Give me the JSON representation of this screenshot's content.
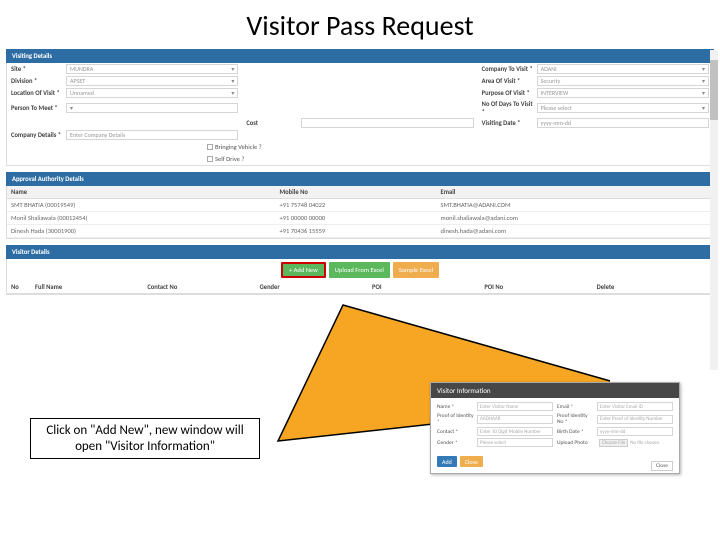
{
  "title": "Visitor Pass Request",
  "sections": {
    "visiting": {
      "header": "Visiting Details"
    },
    "approval": {
      "header": "Approval Authority Details"
    },
    "visitors": {
      "header": "Visitor Details"
    }
  },
  "visiting_details": {
    "site": {
      "label": "Site *",
      "value": "MUNDRA"
    },
    "company_to_visit": {
      "label": "Company To Visit *",
      "value": "ADANI"
    },
    "division": {
      "label": "Division *",
      "value": "APSET"
    },
    "area_of_visit": {
      "label": "Area Of Visit *",
      "value": "Security"
    },
    "location": {
      "label": "Location Of Visit *",
      "value": "Unnamed"
    },
    "purpose": {
      "label": "Purpose Of Visit *",
      "value": "INTERVIEW"
    },
    "person_to_meet": {
      "label": "Person To Meet *",
      "value": ""
    },
    "days_to_visit": {
      "label": "No Of Days To Visit *",
      "value": "Please select"
    },
    "cost": {
      "label": "Cost",
      "value": ""
    },
    "visiting_date": {
      "label": "Visiting Date *",
      "value": "yyyy-mm-dd"
    },
    "company_details": {
      "label": "Company Details *",
      "placeholder": "Enter Company Details"
    },
    "bringing_vehicle": "Bringing Vehicle ?",
    "self_drive": "Self Drive ?"
  },
  "approval_table": {
    "headers": {
      "name": "Name",
      "mobile": "Mobile No",
      "email": "Email"
    },
    "rows": [
      {
        "name": "SMT BHATIA (00019549)",
        "mobile": "+91 75748 04022",
        "email": "SMT.BHATIA@ADANI.COM"
      },
      {
        "name": "Monil Shaliawala (00012454)",
        "mobile": "+91 00000 00000",
        "email": "monil.shaliawala@adani.com"
      },
      {
        "name": "Dinesh Hada (30001900)",
        "mobile": "+91 70436 15559",
        "email": "dinesh.hada@adani.com"
      }
    ]
  },
  "toolbar": {
    "add_new": "+ Add New",
    "upload": "Upload From Excel",
    "sample": "Sample Excel"
  },
  "detail_headers": [
    "No",
    "Full Name",
    "Contact No",
    "Gender",
    "POI",
    "POI No",
    "Delete"
  ],
  "callout": "Click on \"Add New\", new window will open \"Visitor Information\"",
  "modal": {
    "title": "Visitor Information",
    "fields": {
      "name": {
        "label": "Name *",
        "placeholder": "Enter Visitor Name"
      },
      "email": {
        "label": "Email *",
        "placeholder": "Enter Visitor Email ID"
      },
      "poi": {
        "label": "Proof of Identity *",
        "value": "AADHAAR"
      },
      "poi_no": {
        "label": "Proof Identity No *",
        "placeholder": "Enter Proof of Identity Number"
      },
      "contact": {
        "label": "Contact *",
        "placeholder": "Enter 10 Digit Mobile Number"
      },
      "birth_date": {
        "label": "Birth Date *",
        "placeholder": "yyyy-mm-dd"
      },
      "gender": {
        "label": "Gender *",
        "value": "Please select"
      },
      "upload": {
        "label": "Upload Photo",
        "button": "Choose File",
        "status": "No file chosen"
      }
    },
    "add": "Add",
    "close_footer": "Close",
    "close_modal": "Close"
  }
}
